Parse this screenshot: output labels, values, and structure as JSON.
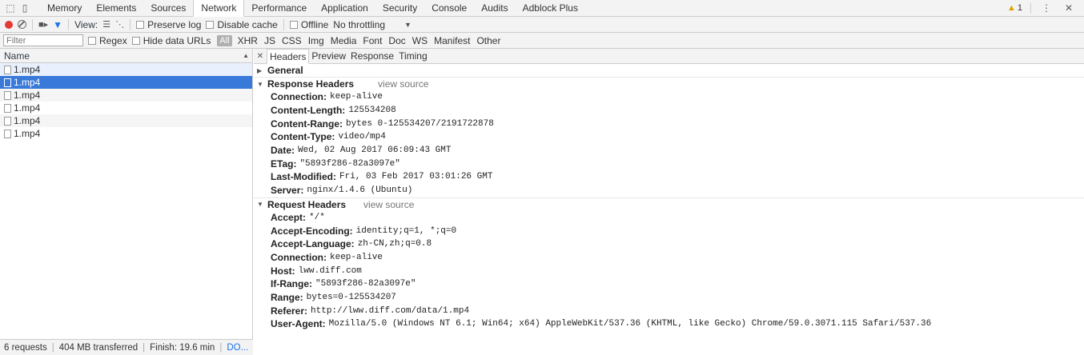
{
  "tabbar": {
    "tabs": [
      "Memory",
      "Elements",
      "Sources",
      "Network",
      "Performance",
      "Application",
      "Security",
      "Console",
      "Audits",
      "Adblock Plus"
    ],
    "active_tab": "Network",
    "warning_count": "1"
  },
  "toolbar": {
    "view_label": "View:",
    "preserve_log": "Preserve log",
    "disable_cache": "Disable cache",
    "offline": "Offline",
    "throttling": "No throttling"
  },
  "filterbar": {
    "placeholder": "Filter",
    "regex": "Regex",
    "hide_data_urls": "Hide data URLs",
    "types": [
      "All",
      "XHR",
      "JS",
      "CSS",
      "Img",
      "Media",
      "Font",
      "Doc",
      "WS",
      "Manifest",
      "Other"
    ]
  },
  "requests": {
    "column_name": "Name",
    "rows": [
      "1.mp4",
      "1.mp4",
      "1.mp4",
      "1.mp4",
      "1.mp4",
      "1.mp4"
    ],
    "selected_index": 1
  },
  "status": {
    "requests": "6 requests",
    "transferred": "404 MB transferred",
    "finish": "Finish: 19.6 min",
    "dom": "DO..."
  },
  "detail": {
    "tabs": [
      "Headers",
      "Preview",
      "Response",
      "Timing"
    ],
    "active_tab": "Headers",
    "general_title": "General",
    "response_title": "Response Headers",
    "request_title": "Request Headers",
    "view_source": "view source",
    "response_headers": [
      {
        "k": "Connection:",
        "v": "keep-alive"
      },
      {
        "k": "Content-Length:",
        "v": "125534208"
      },
      {
        "k": "Content-Range:",
        "v": "bytes 0-125534207/2191722878"
      },
      {
        "k": "Content-Type:",
        "v": "video/mp4"
      },
      {
        "k": "Date:",
        "v": "Wed, 02 Aug 2017 06:09:43 GMT"
      },
      {
        "k": "ETag:",
        "v": "\"5893f286-82a3097e\""
      },
      {
        "k": "Last-Modified:",
        "v": "Fri, 03 Feb 2017 03:01:26 GMT"
      },
      {
        "k": "Server:",
        "v": "nginx/1.4.6 (Ubuntu)"
      }
    ],
    "request_headers": [
      {
        "k": "Accept:",
        "v": "*/*"
      },
      {
        "k": "Accept-Encoding:",
        "v": "identity;q=1, *;q=0"
      },
      {
        "k": "Accept-Language:",
        "v": "zh-CN,zh;q=0.8"
      },
      {
        "k": "Connection:",
        "v": "keep-alive"
      },
      {
        "k": "Host:",
        "v": "lww.diff.com"
      },
      {
        "k": "If-Range:",
        "v": "\"5893f286-82a3097e\""
      },
      {
        "k": "Range:",
        "v": "bytes=0-125534207"
      },
      {
        "k": "Referer:",
        "v": "http://lww.diff.com/data/1.mp4"
      },
      {
        "k": "User-Agent:",
        "v": "Mozilla/5.0 (Windows NT 6.1; Win64; x64) AppleWebKit/537.36 (KHTML, like Gecko) Chrome/59.0.3071.115 Safari/537.36"
      }
    ]
  },
  "colors": {
    "selected_row": "#3879d9",
    "record": "#e53935",
    "link_blue": "#1a73e8"
  }
}
